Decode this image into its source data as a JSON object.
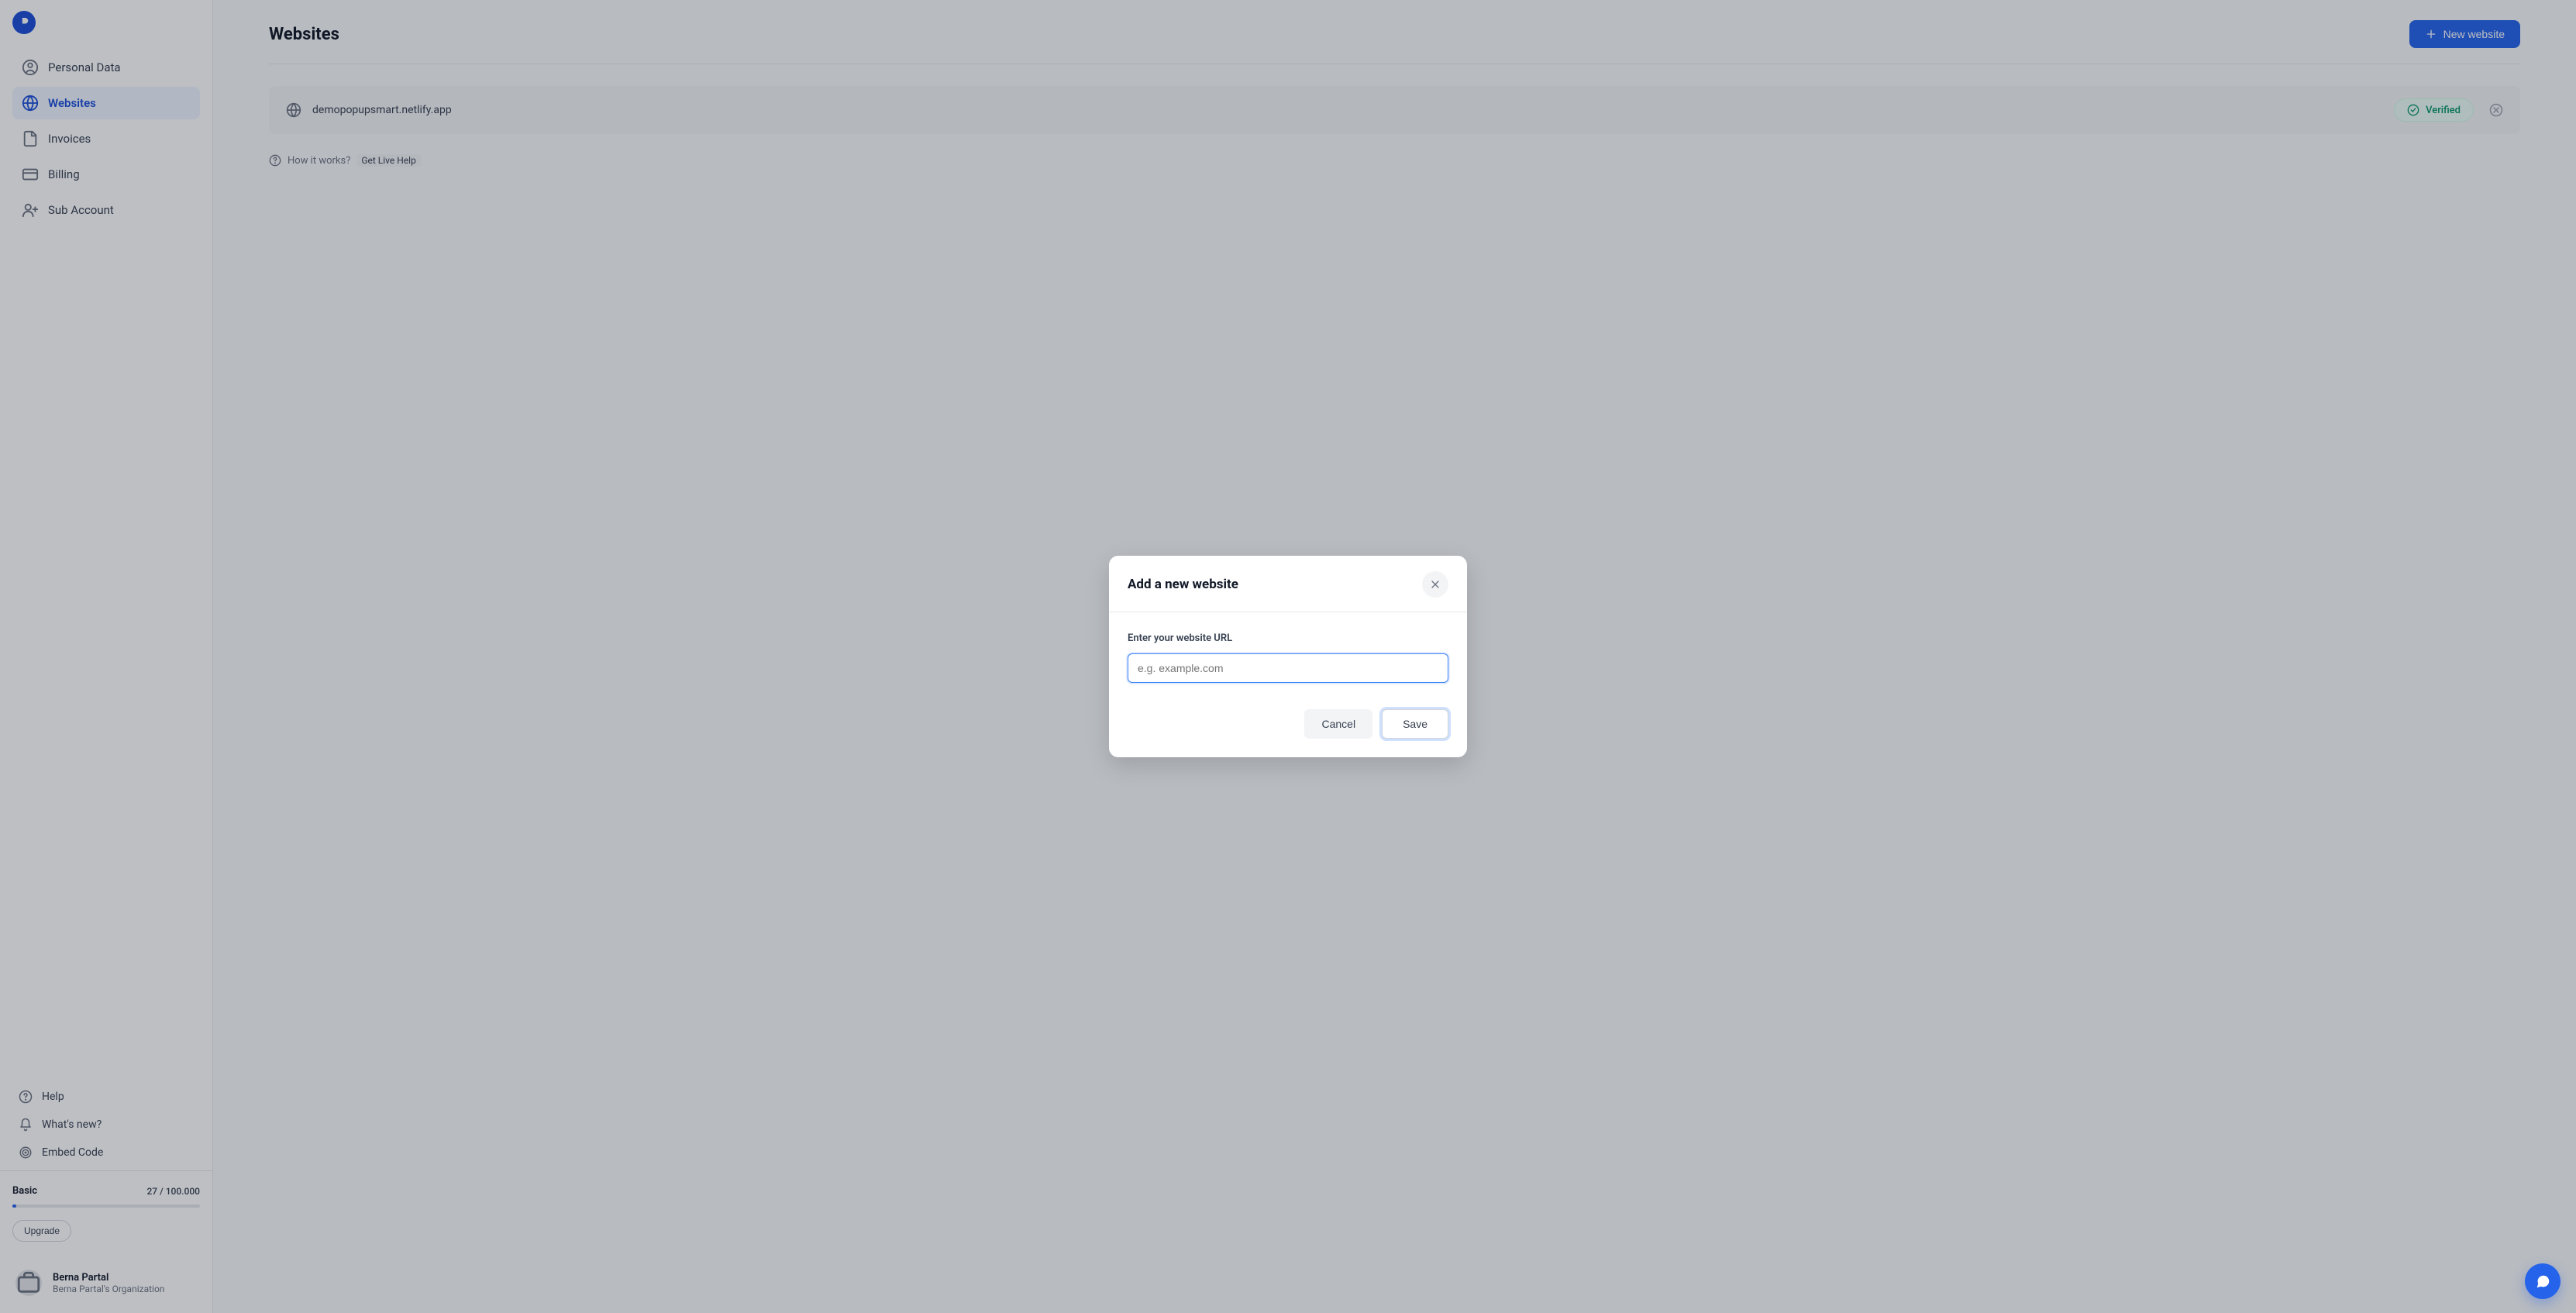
{
  "sidebar": {
    "nav": [
      {
        "label": "Personal Data"
      },
      {
        "label": "Websites"
      },
      {
        "label": "Invoices"
      },
      {
        "label": "Billing"
      },
      {
        "label": "Sub Account"
      }
    ],
    "secondary": [
      {
        "label": "Help"
      },
      {
        "label": "What's new?"
      },
      {
        "label": "Embed Code"
      }
    ],
    "plan": {
      "name": "Basic",
      "usage_text": "27 / 100.000",
      "upgrade_label": "Upgrade"
    },
    "user": {
      "name": "Berna Partal",
      "org": "Berna Partal's Organization"
    }
  },
  "main": {
    "title": "Websites",
    "new_site_label": "New website",
    "site": {
      "domain": "demopopupsmart.netlify.app",
      "status_label": "Verified"
    },
    "howit_label": "How it works?",
    "live_help_label": "Get Live Help"
  },
  "modal": {
    "title": "Add a new website",
    "field_label": "Enter your website URL",
    "placeholder": "e.g. example.com",
    "cancel_label": "Cancel",
    "save_label": "Save"
  }
}
